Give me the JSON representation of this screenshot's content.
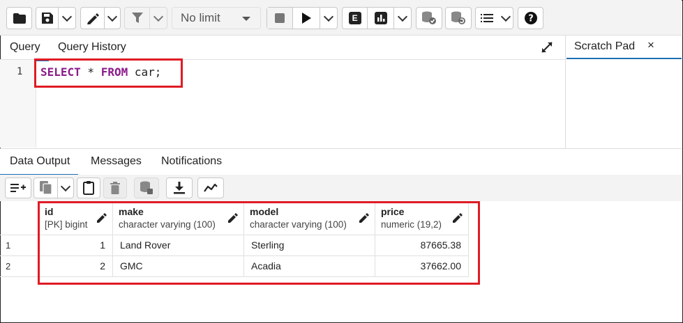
{
  "toolbar": {
    "limit_label": "No limit",
    "explain_label": "E"
  },
  "query_tabs": {
    "query": "Query",
    "history": "Query History"
  },
  "scratch_pad": {
    "label": "Scratch Pad",
    "close": "×"
  },
  "editor": {
    "line_number": "1",
    "kw_select": "SELECT",
    "star": " * ",
    "kw_from": "FROM",
    "rest": " car;"
  },
  "output_tabs": {
    "data_output": "Data Output",
    "messages": "Messages",
    "notifications": "Notifications"
  },
  "grid": {
    "columns": [
      {
        "name": "id",
        "type": "[PK] bigint"
      },
      {
        "name": "make",
        "type": "character varying (100)"
      },
      {
        "name": "model",
        "type": "character varying (100)"
      },
      {
        "name": "price",
        "type": "numeric (19,2)"
      }
    ],
    "rows": [
      {
        "num": "1",
        "id": "1",
        "make": "Land Rover",
        "model": "Sterling",
        "price": "87665.38"
      },
      {
        "num": "2",
        "id": "2",
        "make": "GMC",
        "model": "Acadia",
        "price": "37662.00"
      }
    ]
  }
}
